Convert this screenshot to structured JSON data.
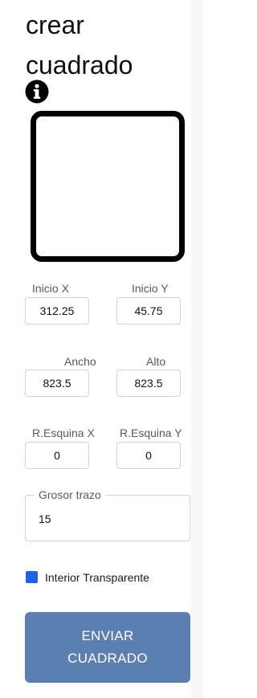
{
  "header": {
    "title": "crear cuadrado"
  },
  "icons": {
    "info": "info-icon"
  },
  "fields": {
    "inicio_x": {
      "label": "Inicio X",
      "value": "312.25"
    },
    "inicio_y": {
      "label": "Inicio Y",
      "value": "45.75"
    },
    "ancho": {
      "label": "Ancho",
      "value": "823.5"
    },
    "alto": {
      "label": "Alto",
      "value": "823.5"
    },
    "resquina_x": {
      "label": "R.Esquina X",
      "value": "0"
    },
    "resquina_y": {
      "label": "R.Esquina Y",
      "value": "0"
    },
    "grosor": {
      "label": "Grosor trazo",
      "value": "15"
    }
  },
  "checkbox": {
    "label": "Interior Transparente",
    "checked": true
  },
  "submit": {
    "label": "ENVIAR CUADRADO"
  },
  "colors": {
    "accent": "#1f63e6",
    "button": "#5c7fb2",
    "border": "#cfd3d8"
  }
}
